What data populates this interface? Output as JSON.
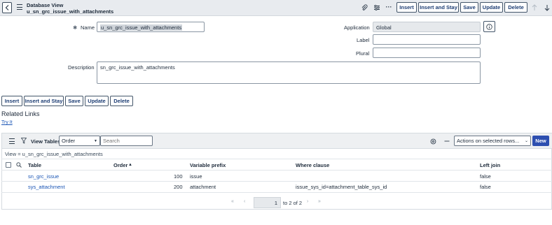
{
  "header": {
    "title_line1": "Database View",
    "title_line2": "u_sn_grc_issue_with_attachments",
    "buttons": {
      "insert": "Insert",
      "insert_and_stay": "Insert and Stay",
      "save": "Save",
      "update": "Update",
      "delete": "Delete"
    },
    "more_label": "···"
  },
  "form": {
    "name_label": "Name",
    "name_required_marker": "✱",
    "name_value": "u_sn_grc_issue_with_attachments",
    "application_label": "Application",
    "application_value": "Global",
    "label_label": "Label",
    "label_value": "",
    "plural_label": "Plural",
    "plural_value": "",
    "description_label": "Description",
    "description_value": "sn_grc_issue_with_attachments"
  },
  "bottom_buttons": {
    "insert": "Insert",
    "insert_and_stay": "Insert and Stay",
    "save": "Save",
    "update": "Update",
    "delete": "Delete"
  },
  "related_links": {
    "title": "Related Links",
    "try_it": "Try It"
  },
  "list": {
    "title": "View Tables",
    "filter_field": "Order",
    "search_placeholder": "Search",
    "actions_label": "Actions on selected rows...",
    "new_label": "New",
    "breadcrumb": "View = u_sn_grc_issue_with_attachments",
    "columns": {
      "table": "Table",
      "order": "Order",
      "sort_indicator": "▲",
      "variable_prefix": "Variable prefix",
      "where_clause": "Where clause",
      "left_join": "Left join"
    },
    "rows": [
      {
        "table": "sn_grc_issue",
        "order": "100",
        "variable_prefix": "issue",
        "where_clause": "",
        "left_join": "false"
      },
      {
        "table": "sys_attachment",
        "order": "200",
        "variable_prefix": "attachment",
        "where_clause": "issue_sys_id=attachment_table_sys_id",
        "left_join": "false"
      }
    ],
    "pagination": {
      "current": "1",
      "range_text": "to 2 of 2"
    }
  }
}
